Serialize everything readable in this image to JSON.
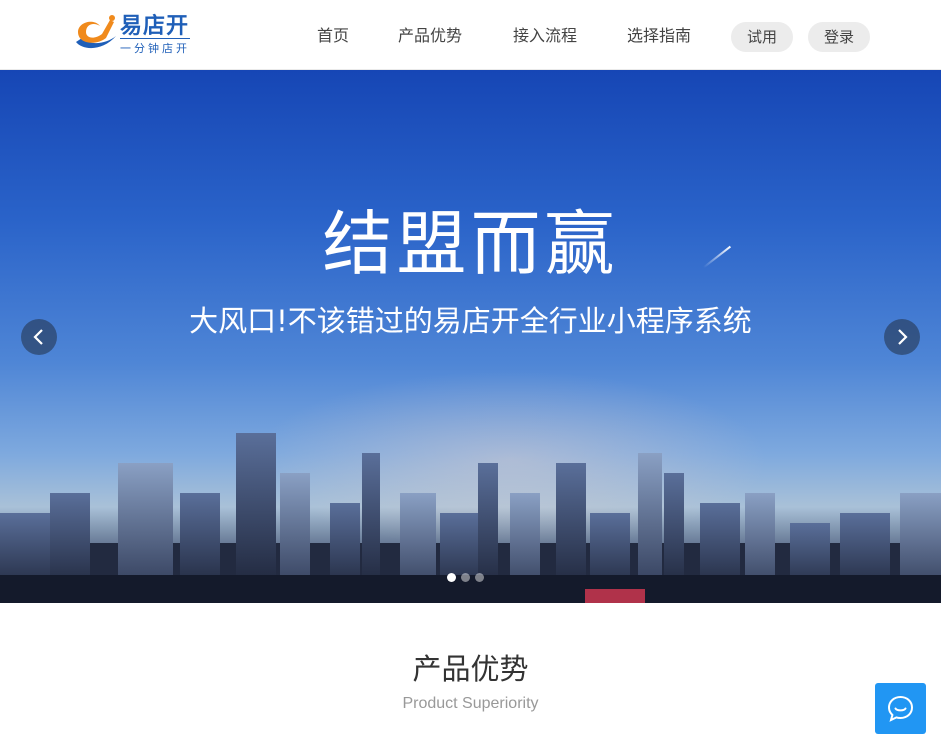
{
  "header": {
    "logo": {
      "title": "易店开",
      "subtitle": "一分钟店开"
    },
    "nav": [
      {
        "label": "首页"
      },
      {
        "label": "产品优势"
      },
      {
        "label": "接入流程"
      },
      {
        "label": "选择指南"
      }
    ],
    "trial_label": "试用",
    "login_label": "登录"
  },
  "banner": {
    "title": "结盟而赢",
    "subtitle": "大风口!不该错过的易店开全行业小程序系统",
    "slides_total": 3,
    "active_slide": 1,
    "prev_icon": "chevron-left-icon",
    "next_icon": "chevron-right-icon"
  },
  "section": {
    "title": "产品优势",
    "subtitle": "Product Superiority"
  },
  "chat": {
    "icon": "chat-bubble-icon"
  },
  "colors": {
    "brand_blue": "#1f5fb8",
    "logo_orange": "#f08a1c",
    "chat_blue": "#2196f3",
    "pill_bg": "#ececec"
  }
}
